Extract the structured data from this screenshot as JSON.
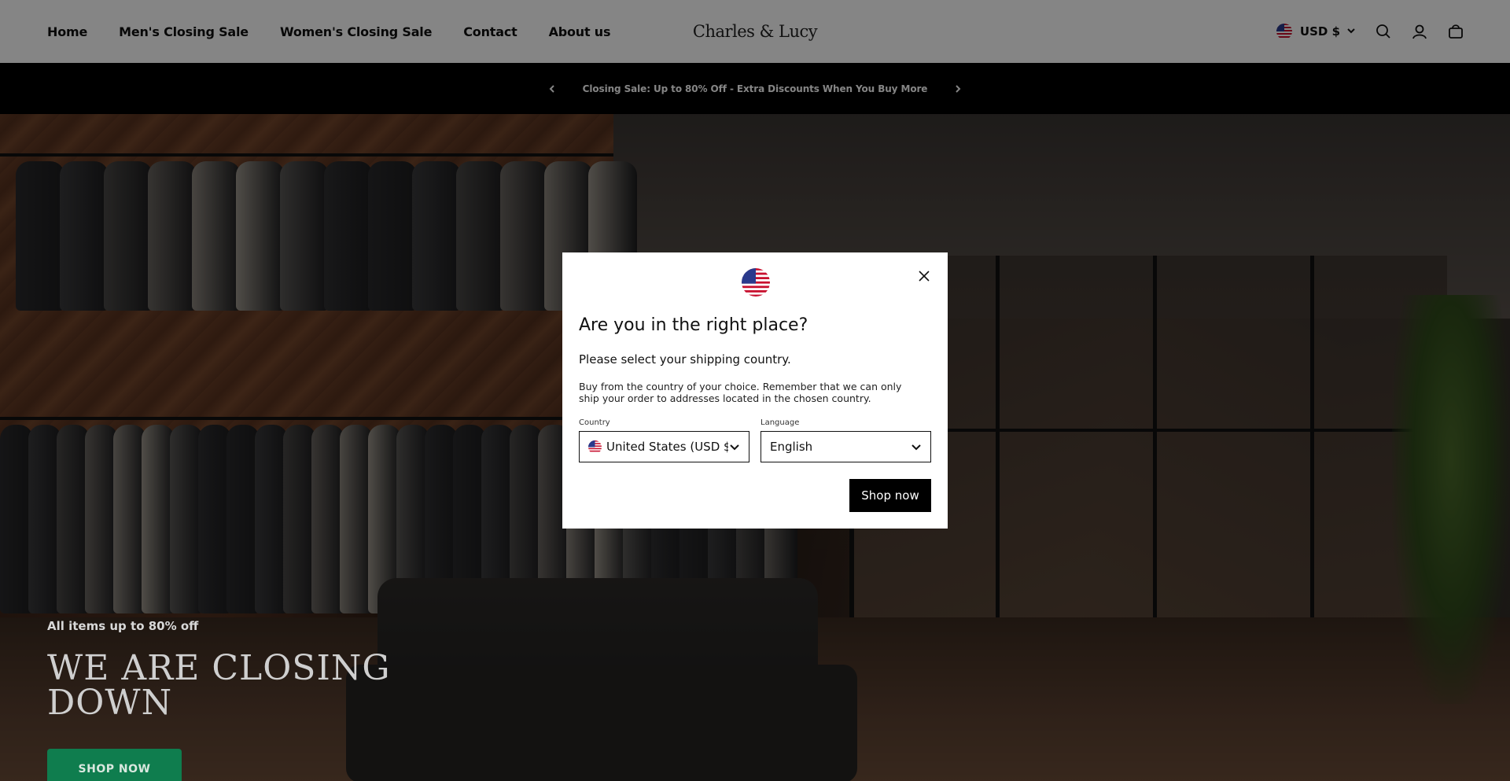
{
  "header": {
    "nav": [
      {
        "label": "Home"
      },
      {
        "label": "Men's Closing Sale"
      },
      {
        "label": "Women's Closing Sale"
      },
      {
        "label": "Contact"
      },
      {
        "label": "About us"
      }
    ],
    "logo": "Charles & Lucy",
    "currency": "USD $",
    "icons": [
      "us-flag-icon",
      "chevron-down-icon",
      "search-icon",
      "account-icon",
      "cart-icon"
    ]
  },
  "announcement": {
    "text": "Closing Sale: Up to 80% Off - Extra Discounts When You Buy More"
  },
  "hero": {
    "eyebrow": "All items up to 80% off",
    "title": "WE ARE CLOSING DOWN",
    "button": "SHOP NOW"
  },
  "modal": {
    "title": "Are you in the right place?",
    "subtitle": "Please select your shipping country.",
    "description": "Buy from the country of your choice. Remember that we can only ship your order to addresses located in the chosen country.",
    "country_label": "Country",
    "country_value": "United States (USD $)",
    "language_label": "Language",
    "language_value": "English",
    "submit": "Shop now"
  },
  "colors": {
    "accent_green": "#0f7d4e",
    "announcement_bg": "#000000",
    "header_bg": "#ffffff"
  }
}
